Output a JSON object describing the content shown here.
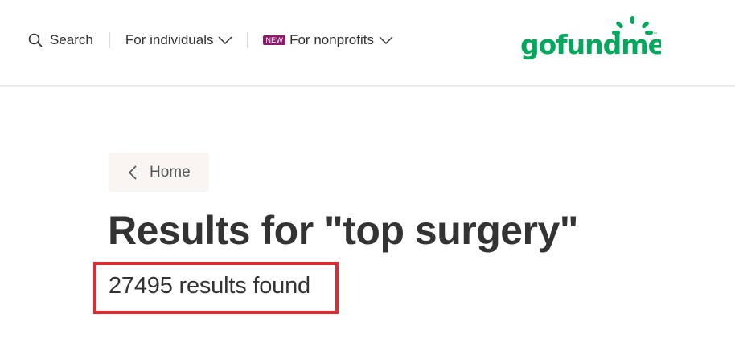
{
  "nav": {
    "search_label": "Search",
    "individuals_label": "For individuals",
    "new_badge": "NEW",
    "nonprofits_label": "For nonprofits"
  },
  "logo": {
    "text": "gofundme",
    "trademark": "™",
    "color": "#02a95c"
  },
  "breadcrumb": {
    "label": "Home"
  },
  "results": {
    "title": "Results for \"top surgery\"",
    "count_text": "27495 results found"
  },
  "colors": {
    "highlight_border": "#e02a2f",
    "new_badge_bg": "#8a1a6b",
    "breadcrumb_bg": "#f8f5f2"
  }
}
